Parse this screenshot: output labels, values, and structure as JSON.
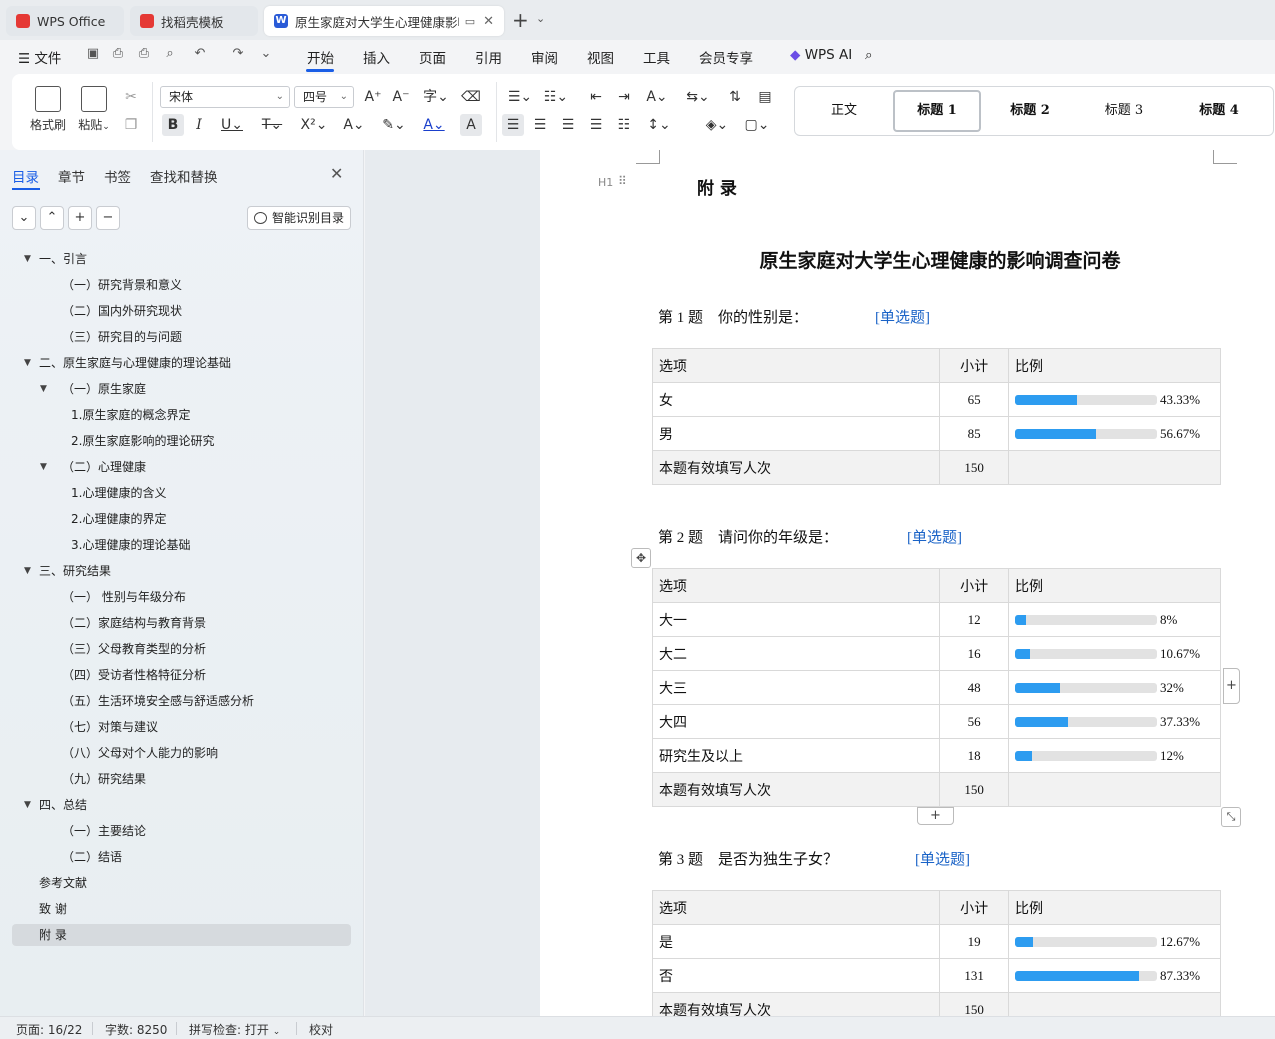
{
  "tabs": [
    {
      "label": "WPS Office"
    },
    {
      "label": "找稻壳模板"
    },
    {
      "label": "原生家庭对大学生心理健康影响"
    }
  ],
  "menu": {
    "file": "文件",
    "items": [
      "开始",
      "插入",
      "页面",
      "引用",
      "审阅",
      "视图",
      "工具",
      "会员专享"
    ],
    "active": "开始",
    "ai": "WPS AI"
  },
  "ribbon": {
    "format_painter": "格式刷",
    "paste": "粘贴",
    "font_name": "宋体",
    "font_size": "四号",
    "styles": [
      "正文",
      "标题 1",
      "标题 2",
      "标题 3",
      "标题 4"
    ],
    "selected_style": "标题 1"
  },
  "sidebar": {
    "tabs": [
      "目录",
      "章节",
      "书签",
      "查找和替换"
    ],
    "smart_toc": "智能识别目录",
    "toc": [
      {
        "label": "一、引言",
        "level": 1,
        "expanded": true
      },
      {
        "label": "（一）研究背景和意义",
        "level": 2
      },
      {
        "label": "（二）国内外研究现状",
        "level": 2
      },
      {
        "label": "（三）研究目的与问题",
        "level": 2
      },
      {
        "label": "二、原生家庭与心理健康的理论基础",
        "level": 1,
        "expanded": true
      },
      {
        "label": "（一）原生家庭",
        "level": 2,
        "expanded": true
      },
      {
        "label": "1.原生家庭的概念界定",
        "level": 3
      },
      {
        "label": "2.原生家庭影响的理论研究",
        "level": 3
      },
      {
        "label": "（二）心理健康",
        "level": 2,
        "expanded": true
      },
      {
        "label": "1.心理健康的含义",
        "level": 3
      },
      {
        "label": "2.心理健康的界定",
        "level": 3
      },
      {
        "label": "3.心理健康的理论基础",
        "level": 3
      },
      {
        "label": "三、研究结果",
        "level": 1,
        "expanded": true
      },
      {
        "label": "（一） 性别与年级分布",
        "level": 2
      },
      {
        "label": "（二）家庭结构与教育背景",
        "level": 2
      },
      {
        "label": "（三）父母教育类型的分析",
        "level": 2
      },
      {
        "label": "（四）受访者性格特征分析",
        "level": 2
      },
      {
        "label": "（五）生活环境安全感与舒适感分析",
        "level": 2
      },
      {
        "label": "（七）对策与建议",
        "level": 2
      },
      {
        "label": "（八）父母对个人能力的影响",
        "level": 2
      },
      {
        "label": "（九）研究结果",
        "level": 2
      },
      {
        "label": "四、总结",
        "level": 1,
        "expanded": true
      },
      {
        "label": "（一）主要结论",
        "level": 2
      },
      {
        "label": "（二）结语",
        "level": 2
      },
      {
        "label": "参考文献",
        "level": 0
      },
      {
        "label": "致   谢",
        "level": 0
      },
      {
        "label": "附   录",
        "level": 0,
        "selected": true
      }
    ]
  },
  "document": {
    "heading": "附   录",
    "heading_marker": "H1",
    "title": "原生家庭对大学生心理健康的影响调查问卷",
    "header_labels": {
      "option": "选项",
      "count": "小计",
      "ratio": "比例"
    },
    "questions": [
      {
        "num": "第 1 题",
        "text": "你的性别是：",
        "type": "[单选题]",
        "rows": [
          {
            "option": "女",
            "count": "65",
            "pct": "43.33%",
            "value": 43.33
          },
          {
            "option": "男",
            "count": "85",
            "pct": "56.67%",
            "value": 56.67
          }
        ],
        "total_label": "本题有效填写人次",
        "total": "150"
      },
      {
        "num": "第 2 题",
        "text": "请问你的年级是：",
        "type": "[单选题]",
        "rows": [
          {
            "option": "大一",
            "count": "12",
            "pct": "8%",
            "value": 8
          },
          {
            "option": "大二",
            "count": "16",
            "pct": "10.67%",
            "value": 10.67
          },
          {
            "option": "大三",
            "count": "48",
            "pct": "32%",
            "value": 32
          },
          {
            "option": "大四",
            "count": "56",
            "pct": "37.33%",
            "value": 37.33
          },
          {
            "option": "研究生及以上",
            "count": "18",
            "pct": "12%",
            "value": 12
          }
        ],
        "total_label": "本题有效填写人次",
        "total": "150"
      },
      {
        "num": "第 3 题",
        "text": "是否为独生子女？",
        "type": "[单选题]",
        "rows": [
          {
            "option": "是",
            "count": "19",
            "pct": "12.67%",
            "value": 12.67
          },
          {
            "option": "否",
            "count": "131",
            "pct": "87.33%",
            "value": 87.33
          }
        ],
        "total_label": "本题有效填写人次",
        "total": "150"
      }
    ]
  },
  "status": {
    "page": "页面: 16/22",
    "words": "字数: 8250",
    "spell": "拼写检查: 打开",
    "proof": "校对"
  },
  "colors": {
    "accent": "#1a5ee6",
    "bar": "#2d9cf0",
    "link": "#1a63c7"
  }
}
